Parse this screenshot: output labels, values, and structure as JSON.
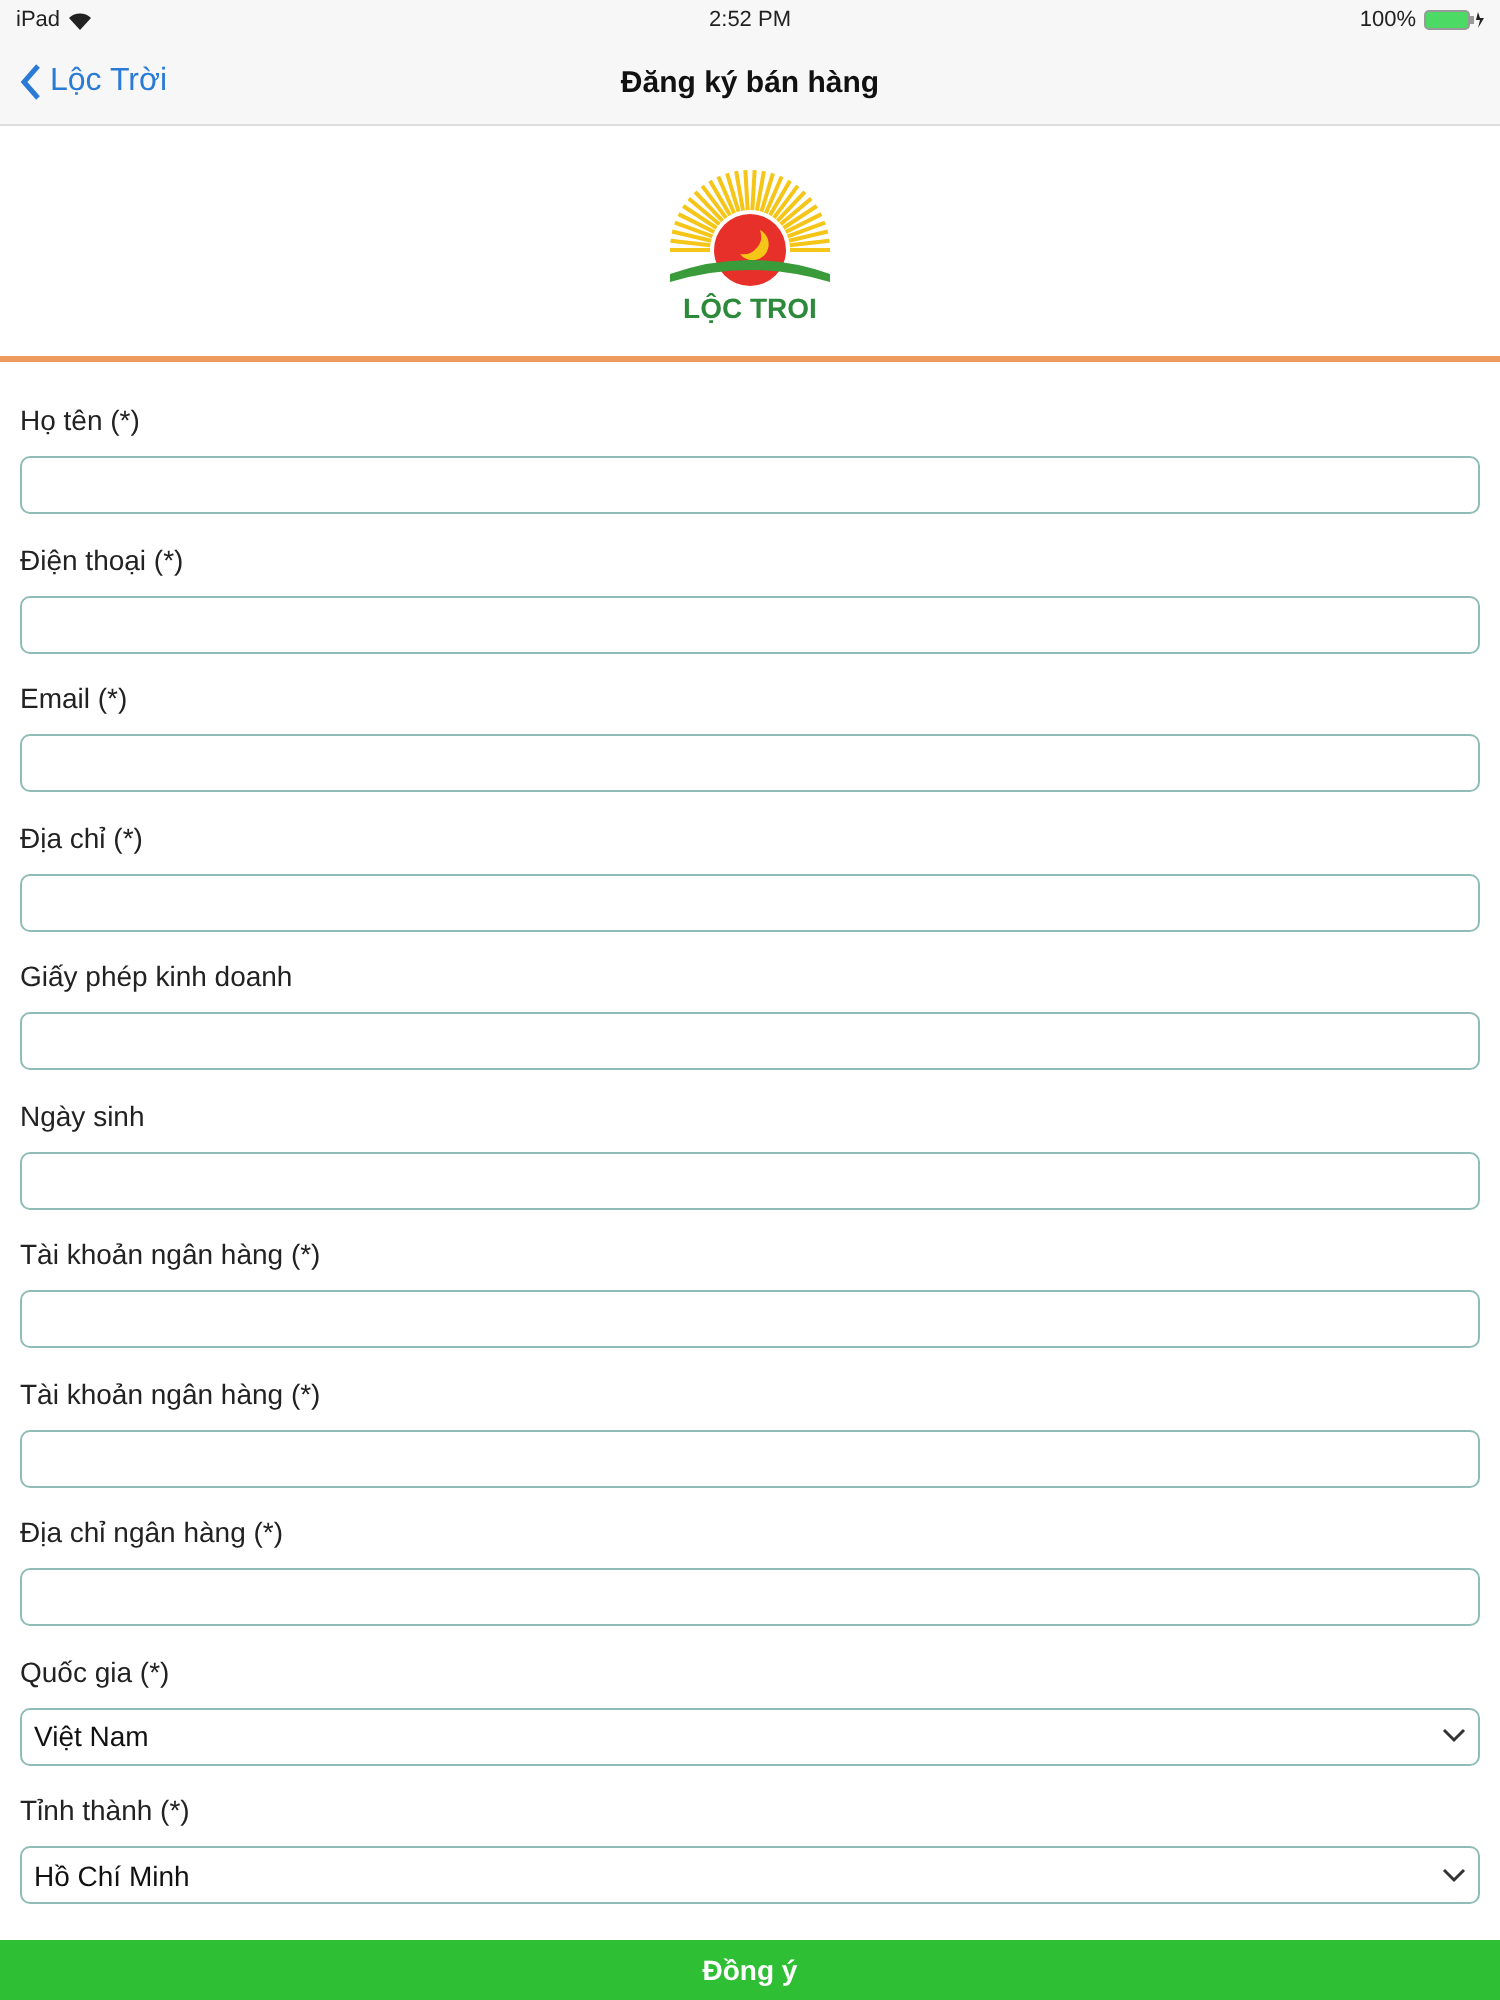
{
  "status_bar": {
    "device": "iPad",
    "time": "2:52 PM",
    "battery": "100%"
  },
  "nav": {
    "back": "Lộc Trời",
    "title": "Đăng ký bán hàng"
  },
  "logo": {
    "text": "LỘC TROI"
  },
  "fields": [
    {
      "kind": "text",
      "label": "Họ tên (*)"
    },
    {
      "kind": "text",
      "label": "Điện thoại (*)"
    },
    {
      "kind": "text",
      "label": "Email (*)"
    },
    {
      "kind": "text",
      "label": "Địa chỉ (*)"
    },
    {
      "kind": "text",
      "label": "Giấy phép kinh doanh"
    },
    {
      "kind": "text",
      "label": "Ngày sinh"
    },
    {
      "kind": "text",
      "label": "Tài khoản ngân hàng (*)"
    },
    {
      "kind": "text",
      "label": "Tài khoản ngân hàng (*)"
    },
    {
      "kind": "text",
      "label": "Địa chỉ ngân hàng (*)"
    },
    {
      "kind": "select",
      "label": "Quốc gia (*)",
      "value": "Việt Nam"
    },
    {
      "kind": "select",
      "label": "Tỉnh thành (*)",
      "value": "Hồ Chí Minh"
    }
  ],
  "submit": "Đồng ý"
}
